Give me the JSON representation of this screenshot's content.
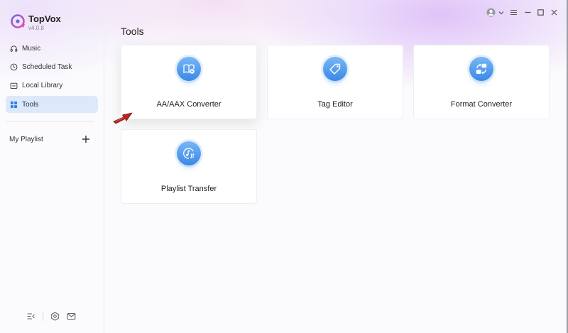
{
  "app": {
    "name": "TopVox",
    "version": "v4.0.8"
  },
  "sidebar": {
    "items": [
      {
        "label": "Music",
        "icon": "headphones-icon"
      },
      {
        "label": "Scheduled Task",
        "icon": "clock-icon"
      },
      {
        "label": "Local Library",
        "icon": "folder-icon"
      },
      {
        "label": "Tools",
        "icon": "grid-icon",
        "active": true
      }
    ],
    "playlist_label": "My Playlist",
    "footer_icons": [
      "menu-collapse-icon",
      "settings-hexagon-icon",
      "mail-icon"
    ]
  },
  "titlebar": {
    "icons": [
      "user-avatar-icon",
      "chevron-down-icon",
      "hamburger-menu-icon",
      "minimize-icon",
      "maximize-icon",
      "close-icon"
    ]
  },
  "main": {
    "title": "Tools",
    "tools": [
      {
        "label": "AA/AAX Converter",
        "icon": "audiobook-icon"
      },
      {
        "label": "Tag Editor",
        "icon": "tag-icon"
      },
      {
        "label": "Format Converter",
        "icon": "format-convert-icon"
      },
      {
        "label": "Playlist Transfer",
        "icon": "music-transfer-icon"
      }
    ]
  },
  "colors": {
    "accent": "#3b88e8",
    "active_nav_bg": "#dde9fb",
    "pointer_arrow": "#c0392b"
  }
}
